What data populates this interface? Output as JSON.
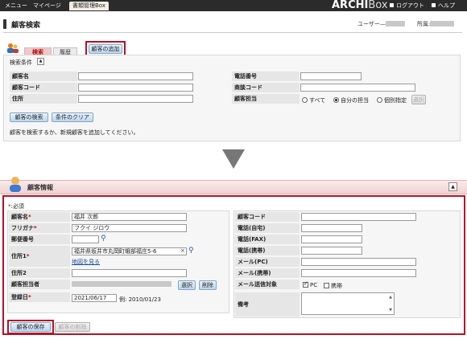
{
  "topnav": {
    "items": [
      "メニュー",
      "マイページ",
      "書類管理Box"
    ],
    "logo_main": "ARCHI",
    "logo_sub": "Box",
    "logout": "ログアウト",
    "help": "ヘルプ"
  },
  "header": {
    "title": "顧客検索",
    "user_label": "ユーザー",
    "dept_label": "所属"
  },
  "search": {
    "tabs": [
      "検索",
      "履歴"
    ],
    "add_button": "顧客の追加",
    "conditions_label": "検索条件",
    "fields": {
      "name": "顧客名",
      "code": "顧客コード",
      "address": "住所",
      "phone": "電話番号",
      "deal_code": "商談コード",
      "owner": "顧客担当"
    },
    "owner_options": [
      "すべて",
      "自分の担当",
      "個別指定"
    ],
    "owner_selected": "自分の担当",
    "select_button": "選択",
    "search_button": "顧客の検索",
    "clear_button": "条件のクリア",
    "hint": "顧客を検索するか、新規顧客を追加してください。"
  },
  "info": {
    "title": "顧客情報",
    "required_note": "必須",
    "required_mark": "*",
    "left_fields": {
      "name": {
        "label": "顧客名",
        "value": "福井 次郎"
      },
      "kana": {
        "label": "フリガナ",
        "value": "フクイ ジロウ"
      },
      "zip": {
        "label": "郵便番号",
        "value": ""
      },
      "address1": {
        "label": "住所1",
        "value": "福井県坂井市丸岡町蛾部福庄5-6"
      },
      "map_link": "地図を見る",
      "address2": {
        "label": "住所2",
        "value": ""
      },
      "owner": {
        "label": "顧客担当者"
      },
      "registered": {
        "label": "登録日",
        "value": "2021/06/17",
        "example": "例: 2010/01/23"
      }
    },
    "owner_select": "選択",
    "owner_delete": "削除",
    "right_fields": {
      "code": "顧客コード",
      "phone_home": "電話(自宅)",
      "phone_fax": "電話(FAX)",
      "phone_mobile": "電話(携帯)",
      "mail_pc": "メール(PC)",
      "mail_mobile": "メール(携帯)",
      "mail_target": "メール送信対象",
      "notes": "備考"
    },
    "mail_options": [
      "PC",
      "携帯"
    ],
    "save_button": "顧客の保存",
    "delete_button": "顧客の削除"
  },
  "colors": {
    "accent_red": "#b3122a",
    "tab_active": "#f3c8c8",
    "header_pink": "#f1d3d3",
    "button_blue": "#bcd6ee"
  }
}
